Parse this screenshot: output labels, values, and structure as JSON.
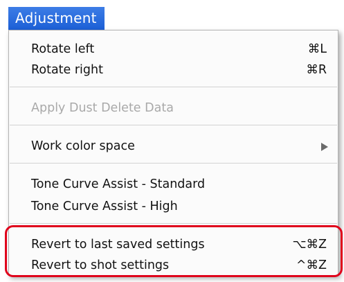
{
  "menu": {
    "title": "Adjustment",
    "items": [
      {
        "label": "Rotate left",
        "shortcut": "⌘L",
        "enabled": true
      },
      {
        "label": "Rotate right",
        "shortcut": "⌘R",
        "enabled": true
      },
      {
        "label": "Apply Dust Delete Data",
        "shortcut": "",
        "enabled": false
      },
      {
        "label": "Work color space",
        "shortcut": "",
        "enabled": true,
        "submenu": true
      },
      {
        "label": "Tone Curve Assist - Standard",
        "shortcut": "",
        "enabled": true
      },
      {
        "label": "Tone Curve Assist - High",
        "shortcut": "",
        "enabled": true
      },
      {
        "label": "Revert to last saved settings",
        "shortcut": "⌥⌘Z",
        "enabled": true
      },
      {
        "label": "Revert to shot settings",
        "shortcut": "^⌘Z",
        "enabled": true
      }
    ]
  },
  "colors": {
    "title_bg": "#1c5fd6",
    "highlight": "#e0001b",
    "disabled_text": "#a9a9a9"
  }
}
